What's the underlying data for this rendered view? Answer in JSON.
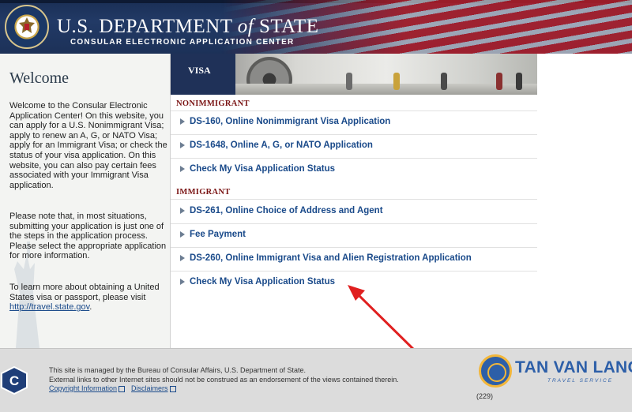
{
  "header": {
    "title_prefix": "U.S. DEPARTMENT ",
    "title_of": "of",
    "title_suffix": " STATE",
    "subtitle": "CONSULAR ELECTRONIC APPLICATION CENTER"
  },
  "sidebar": {
    "title": "Welcome",
    "paragraph1": "Welcome to the Consular Electronic Application Center! On this website, you can apply for a U.S. Nonimmigrant Visa; apply to renew an A, G, or NATO Visa; apply for an Immigrant Visa; or check the status of your visa application. On this website, you can also pay certain fees associated with your Immigrant Visa application.",
    "paragraph2": "Please note that, in most situations, submitting your application is just one of the steps in the application process. Please select the appropriate application for more information.",
    "paragraph3_text": "To learn more about obtaining a United States visa or passport, please visit ",
    "paragraph3_link": "http://travel.state.gov",
    "paragraph3_end": "."
  },
  "banner": {
    "tab_label": "VISA"
  },
  "sections": {
    "nonimmigrant": {
      "heading": "NONIMMIGRANT",
      "items": [
        "DS-160, Online Nonimmigrant Visa Application",
        "DS-1648, Online A, G, or NATO Application",
        "Check My Visa Application Status"
      ]
    },
    "immigrant": {
      "heading": "IMMIGRANT",
      "items": [
        "DS-261, Online Choice of Address and Agent",
        "Fee Payment",
        "DS-260, Online Immigrant Visa and Alien Registration Application",
        "Check My Visa Application Status"
      ]
    }
  },
  "footer": {
    "line1": "This site is managed by the Bureau of Consular Affairs, U.S. Department of State.",
    "line2": "External links to other Internet sites should not be construed as an endorsement of the views contained therein.",
    "link_copyright": "Copyright Information",
    "link_disclaimers": "Disclaimers",
    "count": "(229)"
  },
  "watermark": {
    "brand": "TAN VAN LANG",
    "tagline": "TRAVEL SERVICE"
  },
  "colors": {
    "link": "#1a4a8a",
    "section_heading": "#7a1414",
    "header_navy": "#1a2f55",
    "annotation_arrow": "#e02020"
  }
}
